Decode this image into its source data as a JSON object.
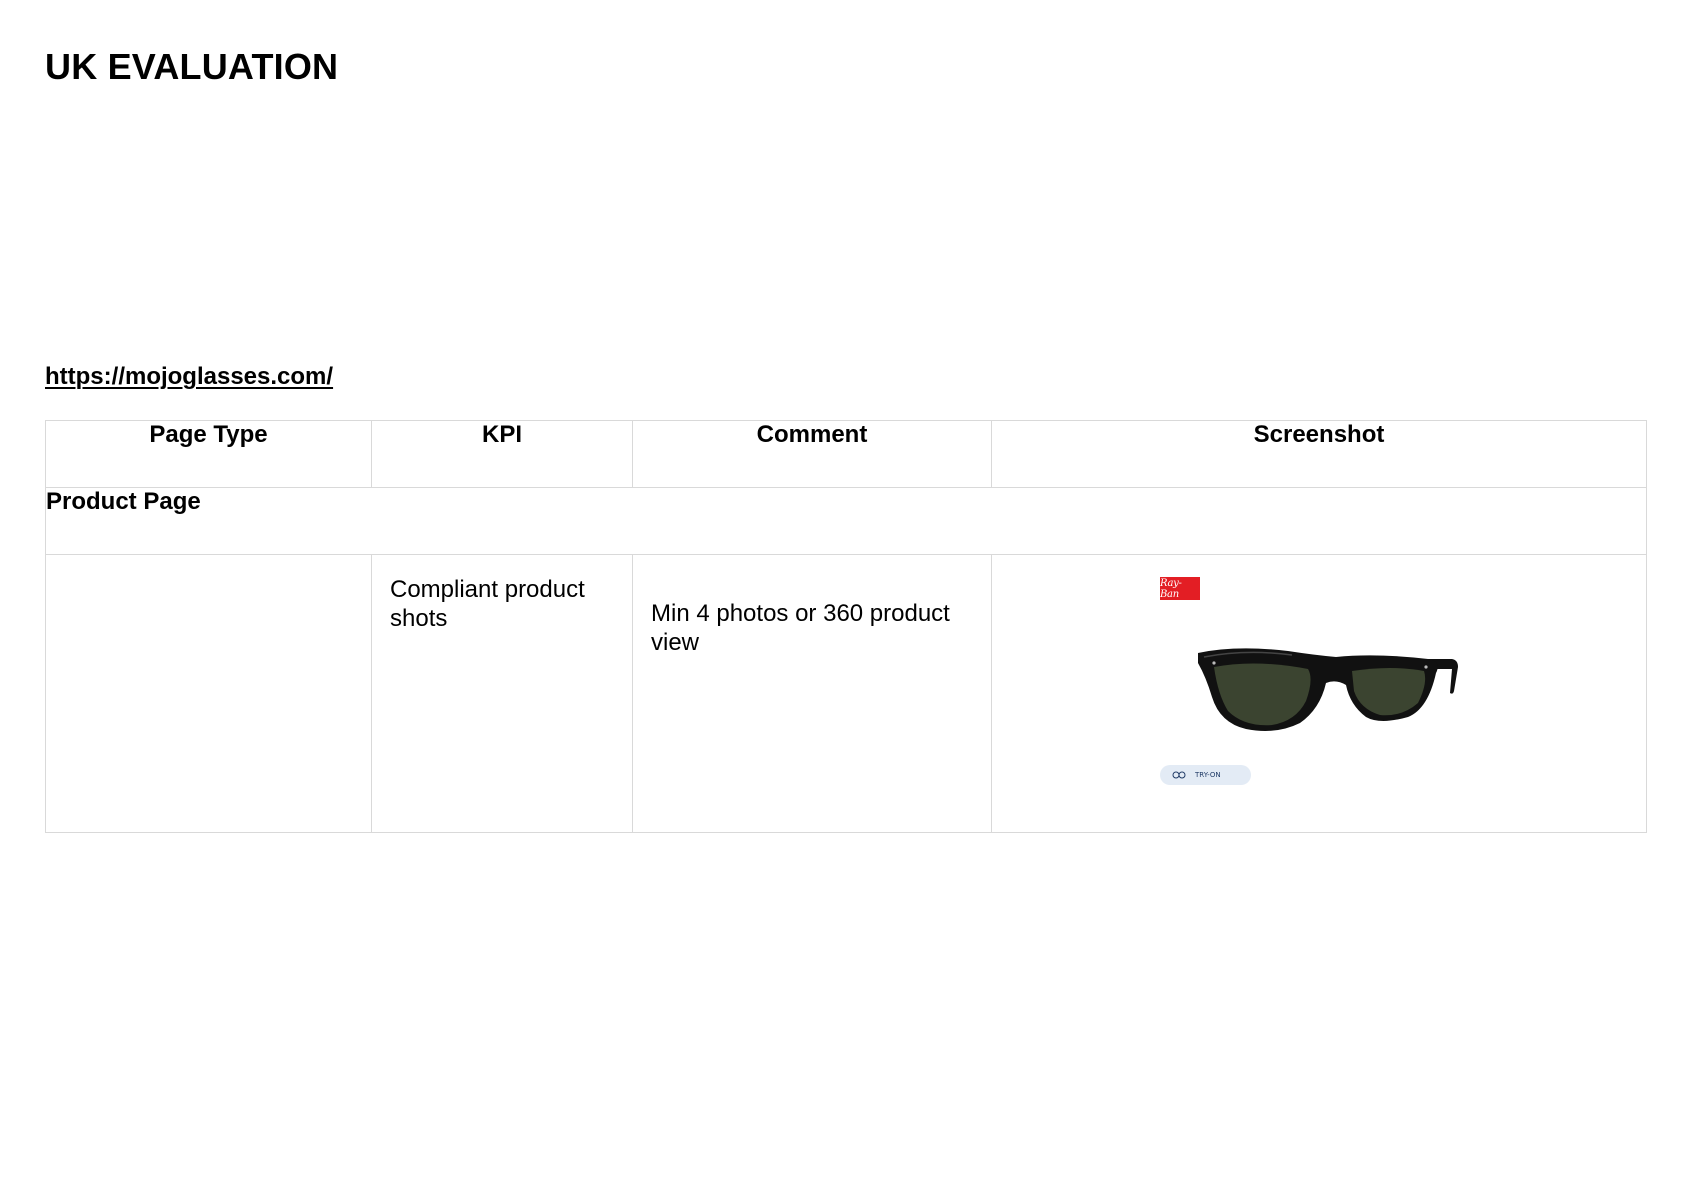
{
  "document": {
    "title": "UK EVALUATION",
    "site_link": "https://mojoglasses.com/"
  },
  "table": {
    "headers": [
      "Page Type",
      "KPI",
      "Comment",
      "Screenshot"
    ],
    "section": "Product Page",
    "rows": [
      {
        "page_type": "",
        "kpi": "Compliant product shots",
        "comment": "Min 4 photos or 360 product view"
      }
    ]
  },
  "screenshot": {
    "brand_logo_text": "Ray-Ban",
    "try_on_label": "TRY-ON",
    "colors": {
      "brand_red": "#e31e24",
      "try_on_bg": "#e3ebf5",
      "lens": "#3b4430",
      "frame": "#111111"
    }
  }
}
